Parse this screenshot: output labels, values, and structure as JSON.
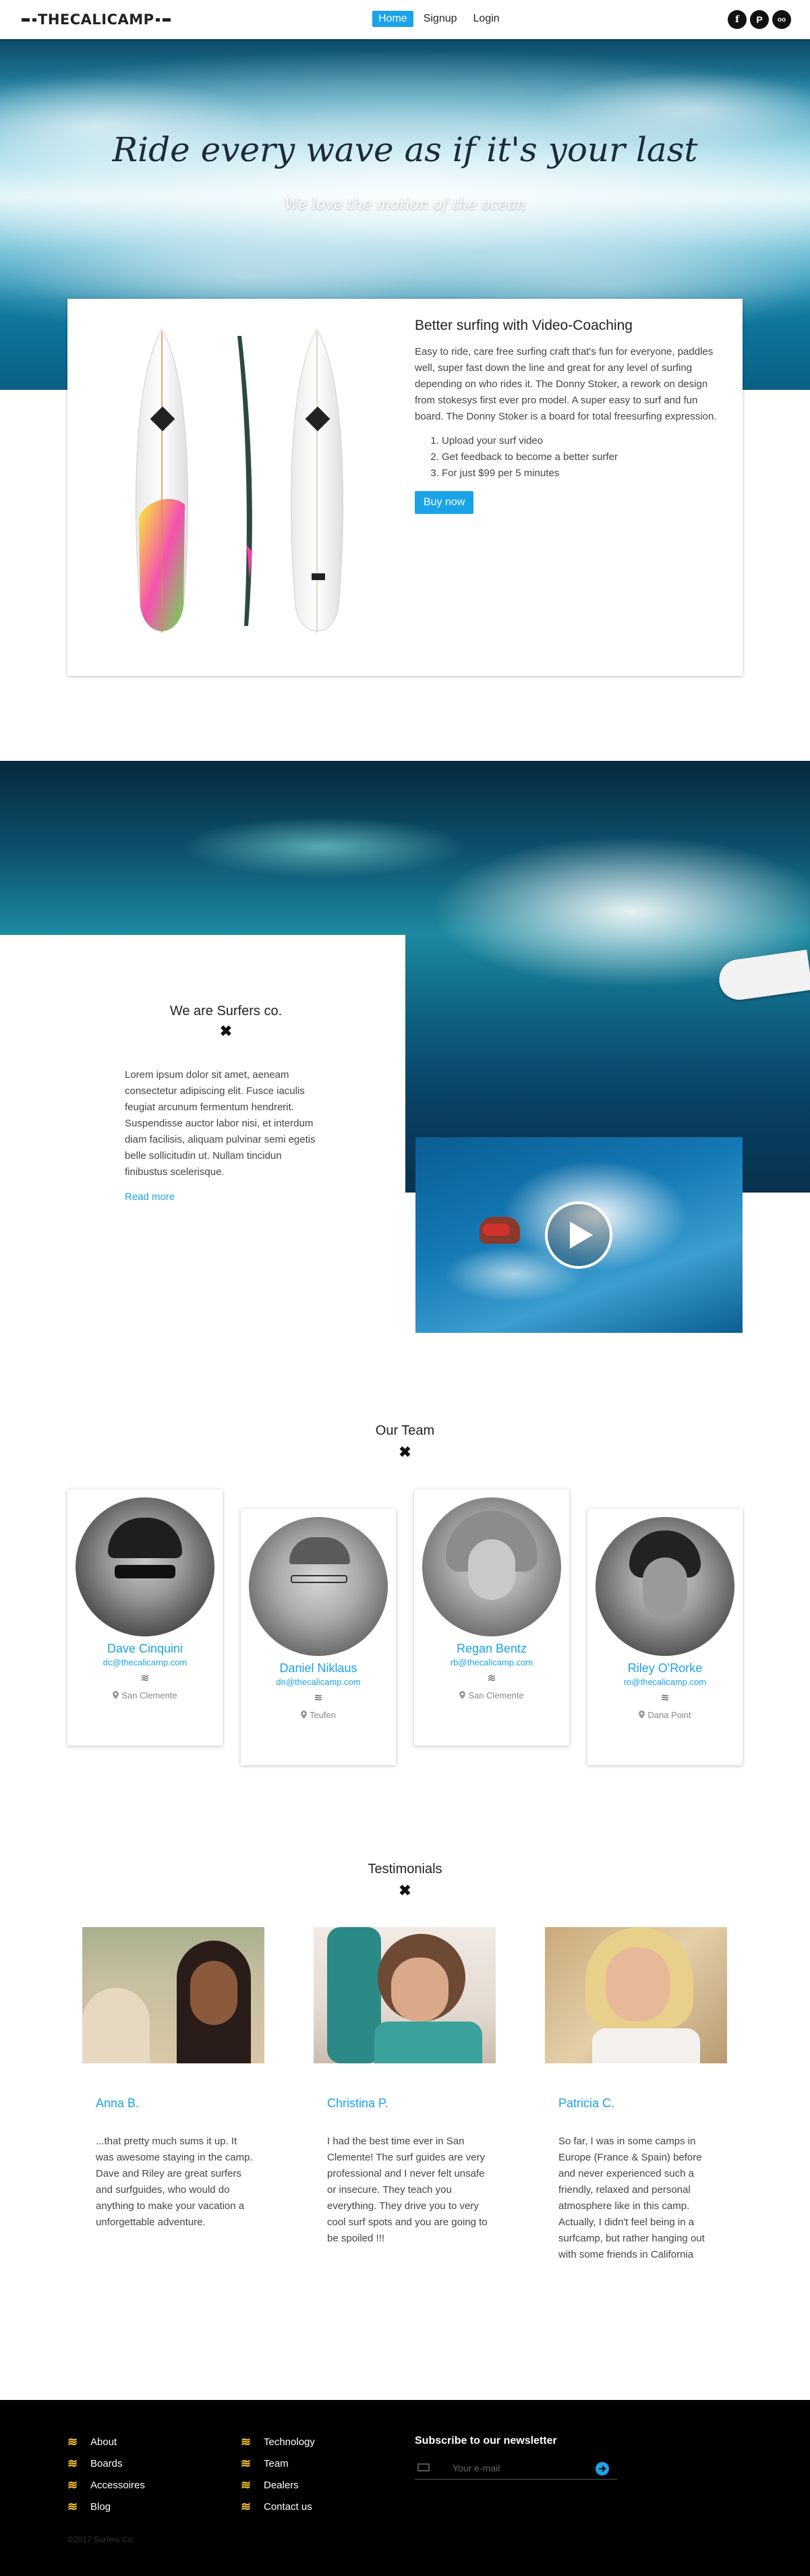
{
  "navbar": {
    "logo_text": "THECALICAMP",
    "links": [
      "Home",
      "Signup",
      "Login"
    ],
    "social": [
      {
        "icon": "facebook-icon",
        "glyph": "f"
      },
      {
        "icon": "pinterest-icon",
        "glyph": "P"
      },
      {
        "icon": "tripadvisor-icon",
        "glyph": "oo"
      }
    ]
  },
  "hero": {
    "title": "Ride every wave as if it's your last",
    "subtitle": "We love the motion of the ocean"
  },
  "coaching": {
    "title": "Better surfing with Video-Coaching",
    "description": "Easy to ride, care free surfing craft that's fun for everyone, paddles well, super fast down the line and great for any level of surfing depending on who rides it. The Donny Stoker, a rework on design from stokesys first ever pro model. A super easy to surf and fun board. The Donny Stoker is a board for total freesurfing expression.",
    "steps": [
      "Upload your surf video",
      "Get feedback to become a better surfer",
      "For just $99 per 5 minutes"
    ],
    "button": "Buy now"
  },
  "about": {
    "title": "We are Surfers co.",
    "cross": "✖",
    "text": "Lorem ipsum dolor sit amet, aeneam consectetur adipiscing elit. Fusce iaculis feugiat arcunum fermentum hendrerit. Suspendisse auctor labor nisi, et interdum diam facilisis, aliquam pulvinar semi egetis belle sollicitudin ut. Nullam tincidun finibustus scelerisque.",
    "read_more": "Read more"
  },
  "team": {
    "title": "Our Team",
    "cross": "✖",
    "members": [
      {
        "name": "Dave Cinquini",
        "email": "dc@thecalicamp.com",
        "wave": "≋",
        "location": "San Clemente"
      },
      {
        "name": "Daniel Niklaus",
        "email": "dn@thecalicamp.com",
        "wave": "≋",
        "location": "Teufen"
      },
      {
        "name": "Regan Bentz",
        "email": "rb@thecalicamp.com",
        "wave": "≋",
        "location": "San Clemente"
      },
      {
        "name": "Riley O'Rorke",
        "email": "ro@thecalicamp.com",
        "wave": "≋",
        "location": "Dana Point"
      }
    ]
  },
  "testimonials": {
    "title": "Testimonials",
    "cross": "✖",
    "items": [
      {
        "name": "Anna B.",
        "text": "...that pretty much sums it up. It was awesome staying in the camp. Dave and Riley are great surfers and surfguides, who would do anything to make your vacation a unforgettable adventure."
      },
      {
        "name": "Christina P.",
        "text": "I had the best time ever in San Clemente! The surf guides are very professional and I never felt unsafe or insecure. They teach you everything. They drive you to very cool surf spots and you are going to be spoiled !!!"
      },
      {
        "name": "Patricia C.",
        "text": "So far, I was in some camps in Europe (France & Spain) before and never experienced such a friendly, relaxed and personal atmosphere like in this camp. Actually, I didn't feel being in a surfcamp, but rather hanging out with some friends in California"
      }
    ]
  },
  "footer": {
    "wave": "≋",
    "col1": [
      "About",
      "Boards",
      "Accessoires",
      "Blog"
    ],
    "col2": [
      "Technology",
      "Team",
      "Dealers",
      "Contact us"
    ],
    "newsletter_title": "Subscribe to our newsletter",
    "newsletter_placeholder": "Your e-mail",
    "copyright": "©2017 Surfers Co"
  },
  "colors": {
    "accent": "#1aa3e8",
    "footer_bg": "#000000",
    "footer_wave": "#f2c12e"
  }
}
